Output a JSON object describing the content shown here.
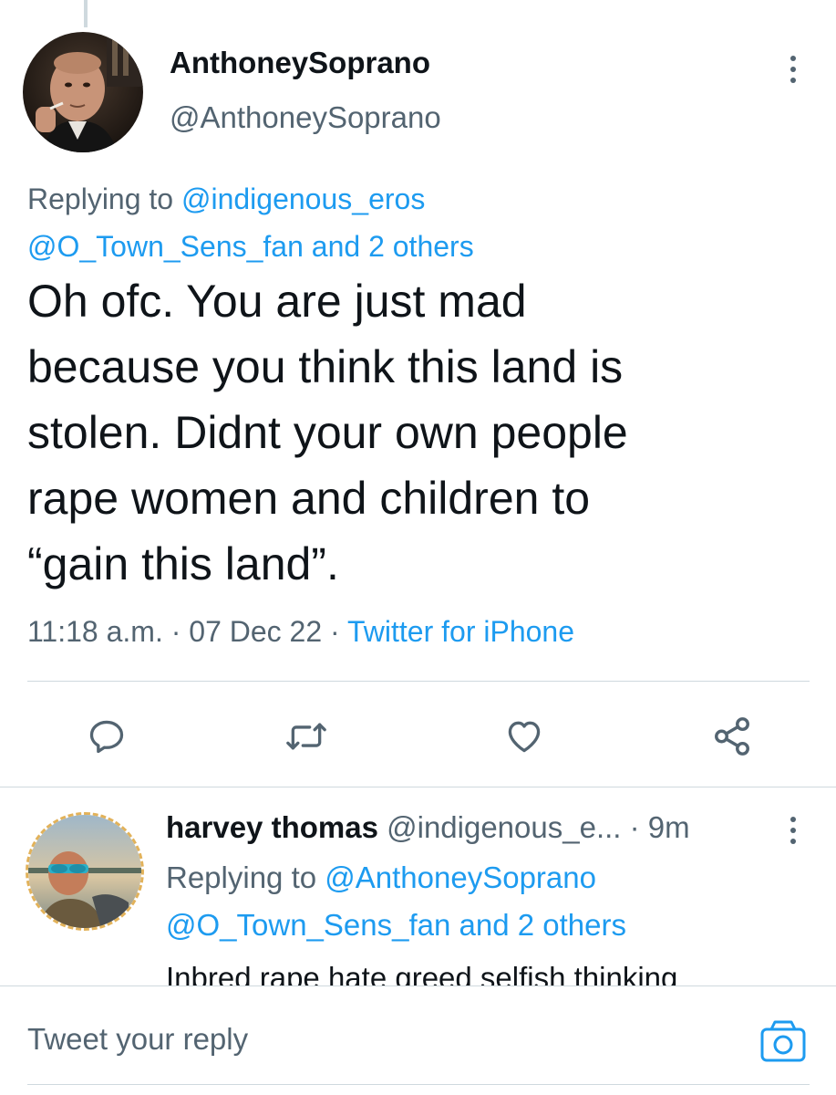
{
  "main_tweet": {
    "author_name": "AnthoneySoprano",
    "author_handle": "@AnthoneySoprano",
    "replying_prefix": "Replying to ",
    "replying_to_1": "@indigenous_eros",
    "replying_to_2": "@O_Town_Sens_fan and 2 others",
    "text": "Oh ofc. You are just mad\nbecause you think this land is\nstolen. Didnt your own people\nrape women and children to\n“gain this land”.",
    "time": "11:18 a.m.",
    "sep1": " · ",
    "date": "07 Dec 22",
    "sep2": " · ",
    "source": "Twitter for iPhone",
    "actions": [
      "reply-icon",
      "retweet-icon",
      "like-icon",
      "share-icon"
    ]
  },
  "reply_tweet": {
    "author_name": "harvey thomas",
    "author_handle": "@indigenous_e...",
    "time": "9m",
    "time_sep": " · ",
    "replying_prefix": "Replying to ",
    "replying_to_1": "@AnthoneySoprano",
    "replying_to_2": "@O_Town_Sens_fan and 2 others",
    "text": "Inbred rape hate greed selfish thinking"
  },
  "reply_bar": {
    "placeholder": "Tweet your reply",
    "camera_icon": "camera-icon"
  },
  "colors": {
    "link": "#1d9bf0",
    "secondary_text": "#536471",
    "primary_text": "#0f1419",
    "divider": "#cfd9de"
  }
}
